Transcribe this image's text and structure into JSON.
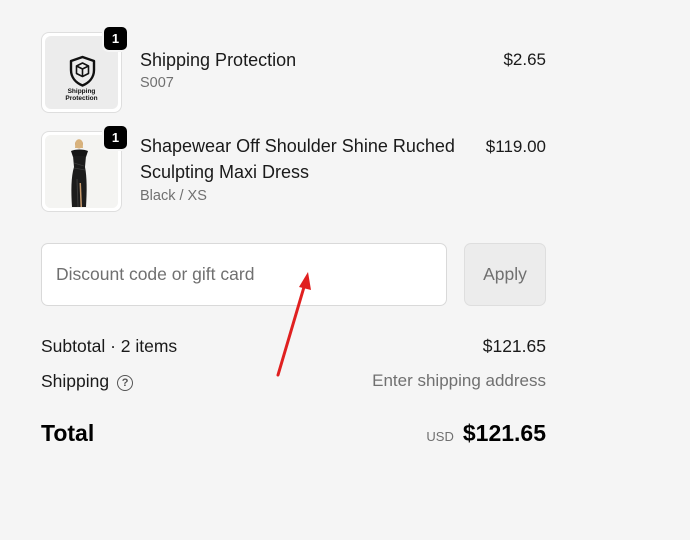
{
  "line_items": [
    {
      "title_lines": [
        "Shipping Protection"
      ],
      "subtitle": "S007",
      "price": "$2.65",
      "quantity": "1",
      "thumbnail_icon": "shield-package-icon",
      "thumbnail_text": [
        "Shipping",
        "Protection"
      ]
    },
    {
      "title_lines": [
        "Shapewear Off Shoulder Shine Ruched",
        "Sculpting Maxi Dress"
      ],
      "subtitle": "Black / XS",
      "price": "$119.00",
      "quantity": "1",
      "thumbnail_icon": "dress-photo"
    }
  ],
  "discount": {
    "placeholder": "Discount code or gift card",
    "apply_label": "Apply"
  },
  "summary": {
    "subtotal_label": "Subtotal · 2 items",
    "subtotal_value": "$121.65",
    "shipping_label": "Shipping",
    "shipping_help_icon": "question-circle-icon",
    "shipping_value": "Enter shipping address",
    "total_label": "Total",
    "currency": "USD",
    "total_value": "$121.65"
  },
  "annotation": {
    "icon": "red-arrow",
    "color": "#e02020"
  }
}
